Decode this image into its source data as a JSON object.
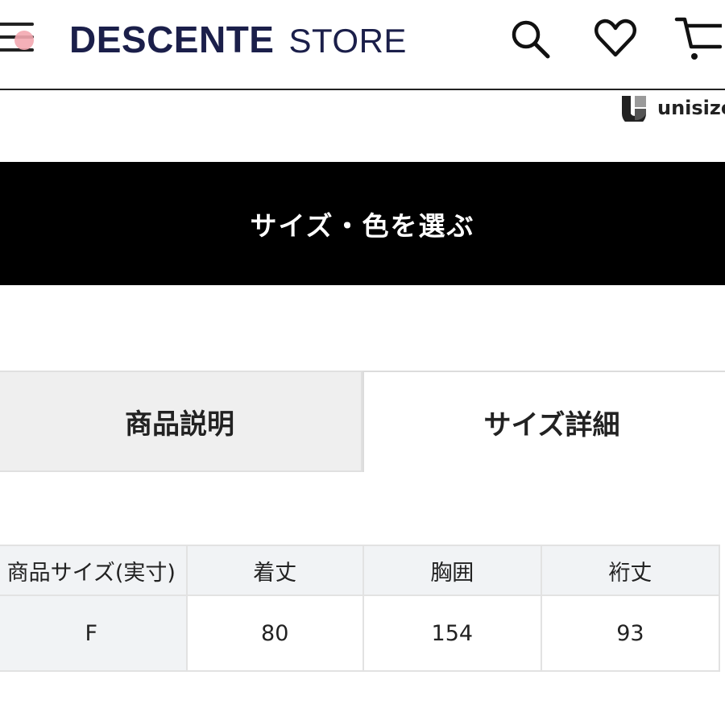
{
  "header": {
    "brand": "DESCENTE",
    "store": "STORE",
    "icons": [
      "menu-icon",
      "search-icon",
      "heart-icon",
      "cart-icon"
    ]
  },
  "unisize": {
    "label": "unisize"
  },
  "select_button": {
    "label": "サイズ・色を選ぶ"
  },
  "tabs": [
    {
      "label": "商品説明",
      "active": false
    },
    {
      "label": "サイズ詳細",
      "active": true
    }
  ],
  "size_table": {
    "headers": [
      "商品サイズ(実寸)",
      "着丈",
      "胸囲",
      "裄丈"
    ],
    "rows": [
      [
        "F",
        "80",
        "154",
        "93"
      ]
    ]
  },
  "colors": {
    "brand_navy": "#1b1f4a",
    "button_black": "#000000",
    "notification_pink": "#f3a7b0"
  }
}
